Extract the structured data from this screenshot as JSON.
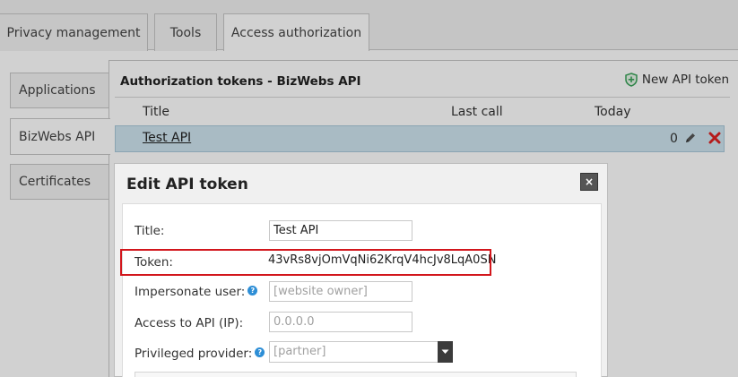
{
  "top_tabs": {
    "privacy": "Privacy management",
    "tools": "Tools",
    "access": "Access authorization"
  },
  "side_tabs": {
    "applications": "Applications",
    "bizwebs": "BizWebs API",
    "certificates": "Certificates"
  },
  "panel": {
    "title": "Authorization tokens - BizWebs API",
    "new_token_label": "New API token",
    "columns": {
      "title": "Title",
      "last_call": "Last call",
      "today": "Today"
    },
    "rows": [
      {
        "title": "Test API",
        "last_call": "",
        "today": "0"
      }
    ]
  },
  "modal": {
    "title": "Edit API token",
    "close_label": "×",
    "fields": {
      "title_label": "Title:",
      "title_value": "Test API",
      "token_label": "Token:",
      "token_value": "43vRs8vjOmVqNi62KrqV4hcJv8LqA0SN",
      "impersonate_label": "Impersonate user:",
      "impersonate_placeholder": "[website owner]",
      "access_label": "Access to API (IP):",
      "access_placeholder": "0.0.0.0",
      "privileged_label": "Privileged provider:",
      "privileged_value": "[partner]"
    },
    "help_glyph": "?"
  },
  "colors": {
    "highlight": "#d2161c",
    "row_selected": "#cfe5ef",
    "help_icon": "#2d8ed6",
    "shield": "#3aa35a"
  }
}
